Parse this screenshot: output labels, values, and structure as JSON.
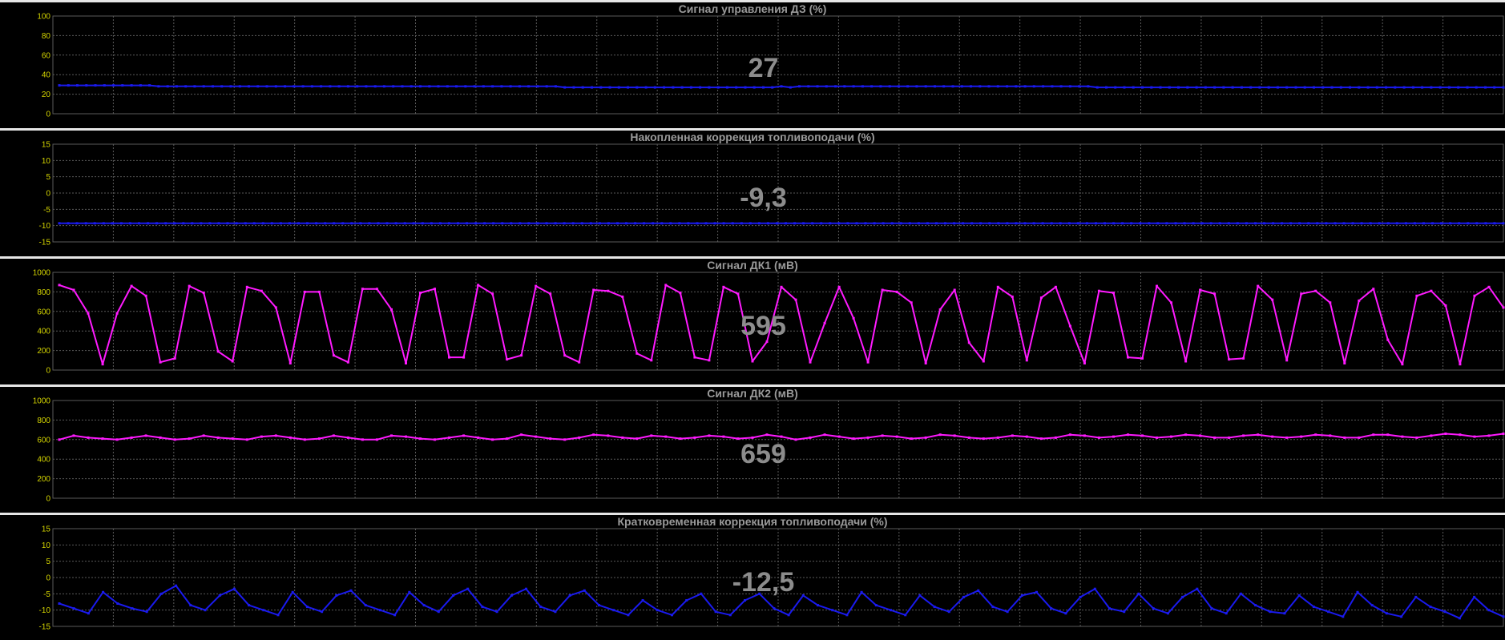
{
  "colors": {
    "blue": "#1a1aee",
    "magenta": "#ff1aff",
    "grid": "#5a5a5a",
    "tick": "#d4d400"
  },
  "panels": [
    {
      "title": "Сигнал управления ДЗ  (%)",
      "value": "27",
      "color": "blue",
      "yticks": [
        "100",
        "80",
        "60",
        "40",
        "20",
        "0"
      ],
      "ymin": 0,
      "ymax": 100,
      "values": [
        29,
        29,
        29,
        29,
        29,
        29,
        29,
        29,
        29,
        29,
        29,
        28,
        28,
        28,
        28,
        28,
        28,
        28,
        28,
        28,
        28,
        28,
        28,
        28,
        28,
        28,
        28,
        28,
        28,
        28,
        28,
        28,
        28,
        28,
        28,
        28,
        28,
        28,
        28,
        28,
        28,
        28,
        28,
        28,
        28,
        28,
        28,
        28,
        28,
        28,
        28,
        28,
        28,
        28,
        28,
        28,
        27,
        27,
        27,
        27,
        27,
        27,
        27,
        27,
        27,
        27,
        27,
        27,
        27,
        27,
        27,
        27,
        27,
        27,
        27,
        27,
        27,
        27,
        27,
        27,
        28,
        27,
        28,
        28,
        28,
        28,
        28,
        28,
        28,
        28,
        28,
        28,
        28,
        28,
        28,
        28,
        28,
        28,
        28,
        28,
        28,
        28,
        28,
        28,
        28,
        28,
        28,
        28,
        28,
        28,
        28,
        28,
        28,
        28,
        28,
        27,
        27,
        27,
        27,
        27,
        27,
        27,
        27,
        27,
        27,
        27,
        27,
        27,
        27,
        27,
        27,
        27,
        27,
        27,
        27,
        27,
        27,
        27,
        27,
        27,
        27,
        27,
        27,
        27,
        27,
        27,
        27,
        27,
        27,
        27,
        27,
        27,
        27,
        27,
        27,
        27,
        27,
        27,
        27,
        27,
        27
      ]
    },
    {
      "title": "Накопленная коррекция топливоподачи  (%)",
      "value": "-9,3",
      "color": "blue",
      "yticks": [
        "15",
        "10",
        "5",
        "0",
        "-5",
        "-10",
        "-15"
      ],
      "ymin": -15,
      "ymax": 15,
      "values": [
        -9.3,
        -9.3,
        -9.3,
        -9.3,
        -9.3,
        -9.3,
        -9.3,
        -9.3,
        -9.3,
        -9.3,
        -9.3,
        -9.3,
        -9.3,
        -9.3,
        -9.3,
        -9.3,
        -9.3,
        -9.3,
        -9.3,
        -9.3,
        -9.3,
        -9.3,
        -9.3,
        -9.3,
        -9.3,
        -9.3,
        -9.3,
        -9.3,
        -9.3,
        -9.3,
        -9.3,
        -9.3,
        -9.3,
        -9.3,
        -9.3,
        -9.3,
        -9.3,
        -9.3,
        -9.3,
        -9.3,
        -9.3,
        -9.3,
        -9.3,
        -9.3,
        -9.3,
        -9.3,
        -9.3,
        -9.3,
        -9.3,
        -9.3,
        -9.3,
        -9.3,
        -9.3,
        -9.3,
        -9.3,
        -9.3,
        -9.3,
        -9.3,
        -9.3,
        -9.3,
        -9.3,
        -9.3,
        -9.3,
        -9.3,
        -9.3,
        -9.3,
        -9.3,
        -9.3,
        -9.3,
        -9.3,
        -9.3,
        -9.3,
        -9.3,
        -9.3,
        -9.3,
        -9.3,
        -9.3,
        -9.3,
        -9.3,
        -9.3,
        -9.3,
        -9.3,
        -9.3,
        -9.3,
        -9.3,
        -9.3,
        -9.3,
        -9.3,
        -9.3,
        -9.3,
        -9.3,
        -9.3,
        -9.3,
        -9.3,
        -9.3,
        -9.3,
        -9.3,
        -9.3,
        -9.3,
        -9.3,
        -9.3,
        -9.3,
        -9.3,
        -9.3,
        -9.3,
        -9.3,
        -9.3,
        -9.3,
        -9.3,
        -9.3,
        -9.3,
        -9.3,
        -9.3,
        -9.3,
        -9.3,
        -9.3,
        -9.3,
        -9.3,
        -9.3,
        -9.3,
        -9.3,
        -9.3,
        -9.3,
        -9.3,
        -9.3,
        -9.3,
        -9.3,
        -9.3,
        -9.3,
        -9.3,
        -9.3,
        -9.3,
        -9.3,
        -9.3,
        -9.3,
        -9.3,
        -9.3,
        -9.3,
        -9.3,
        -9.3,
        -9.3,
        -9.3,
        -9.3,
        -9.3,
        -9.3,
        -9.3,
        -9.3,
        -9.3,
        -9.3,
        -9.3,
        -9.3,
        -9.3,
        -9.3,
        -9.3,
        -9.3,
        -9.3,
        -9.3,
        -9.3,
        -9.3,
        -9.3,
        -9.3,
        -9.3,
        -9.3,
        -9.3
      ]
    },
    {
      "title": "Сигнал ДК1  (мВ)",
      "value": "595",
      "color": "magenta",
      "yticks": [
        "1000",
        "800",
        "600",
        "400",
        "200",
        "0"
      ],
      "ymin": 0,
      "ymax": 1000,
      "values": [
        870,
        820,
        580,
        60,
        580,
        860,
        760,
        80,
        120,
        860,
        790,
        190,
        90,
        850,
        810,
        640,
        70,
        800,
        800,
        150,
        80,
        830,
        830,
        620,
        70,
        790,
        830,
        130,
        130,
        870,
        780,
        110,
        150,
        860,
        780,
        150,
        80,
        820,
        810,
        750,
        170,
        100,
        870,
        790,
        130,
        100,
        850,
        780,
        90,
        290,
        850,
        720,
        80,
        480,
        850,
        530,
        80,
        820,
        800,
        690,
        70,
        620,
        820,
        280,
        90,
        850,
        750,
        100,
        740,
        850,
        450,
        70,
        810,
        790,
        130,
        120,
        860,
        690,
        90,
        820,
        780,
        110,
        120,
        860,
        720,
        100,
        780,
        810,
        690,
        70,
        710,
        830,
        310,
        60,
        760,
        810,
        660,
        60,
        760,
        850,
        640
      ]
    },
    {
      "title": "Сигнал ДК2  (мВ)",
      "value": "659",
      "color": "magenta",
      "yticks": [
        "1000",
        "800",
        "600",
        "400",
        "200",
        "0"
      ],
      "ymin": 0,
      "ymax": 1000,
      "values": [
        600,
        640,
        620,
        610,
        600,
        620,
        640,
        620,
        600,
        610,
        640,
        620,
        610,
        600,
        630,
        640,
        620,
        600,
        610,
        640,
        620,
        600,
        600,
        640,
        630,
        610,
        600,
        620,
        640,
        620,
        600,
        610,
        650,
        630,
        610,
        600,
        620,
        650,
        640,
        620,
        610,
        640,
        630,
        610,
        620,
        640,
        630,
        610,
        620,
        650,
        630,
        600,
        620,
        650,
        630,
        610,
        620,
        640,
        630,
        610,
        620,
        650,
        640,
        620,
        610,
        620,
        640,
        630,
        610,
        620,
        650,
        640,
        620,
        630,
        650,
        640,
        620,
        630,
        650,
        640,
        620,
        620,
        640,
        650,
        630,
        620,
        630,
        650,
        640,
        620,
        620,
        650,
        650,
        630,
        620,
        640,
        660,
        650,
        630,
        640,
        660
      ]
    },
    {
      "title": "Кратковременная коррекция топливоподачи  (%)",
      "value": "-12,5",
      "color": "blue",
      "yticks": [
        "15",
        "10",
        "5",
        "0",
        "-5",
        "-10",
        "-15"
      ],
      "ymin": -15,
      "ymax": 15,
      "values": [
        -8,
        -9.5,
        -11,
        -4.5,
        -8,
        -9.5,
        -10.5,
        -5,
        -2.5,
        -8.5,
        -10,
        -5.5,
        -3.5,
        -8.5,
        -10,
        -11.5,
        -4.5,
        -9,
        -10.5,
        -5.5,
        -4,
        -8.5,
        -10,
        -11.5,
        -4.5,
        -8.5,
        -10.5,
        -5.5,
        -3.5,
        -9,
        -10.5,
        -5.5,
        -3.5,
        -9,
        -10.5,
        -5.5,
        -4,
        -8.5,
        -10,
        -11.5,
        -7,
        -10,
        -11.5,
        -7,
        -5,
        -10.5,
        -11.5,
        -7,
        -5,
        -9.5,
        -11.5,
        -5.5,
        -8.5,
        -10,
        -11.5,
        -4.5,
        -8.5,
        -10,
        -11.5,
        -5.5,
        -9,
        -10.5,
        -6,
        -4,
        -9,
        -10.5,
        -5.5,
        -4.5,
        -9.5,
        -11,
        -6,
        -3.5,
        -9.5,
        -10.5,
        -5,
        -9.5,
        -11,
        -6,
        -3.5,
        -9.5,
        -11,
        -5,
        -8.5,
        -10.5,
        -11,
        -5.5,
        -9,
        -10.5,
        -12,
        -4.5,
        -8.5,
        -11,
        -12,
        -6,
        -9,
        -10.5,
        -12.5,
        -6,
        -10,
        -12
      ]
    }
  ]
}
